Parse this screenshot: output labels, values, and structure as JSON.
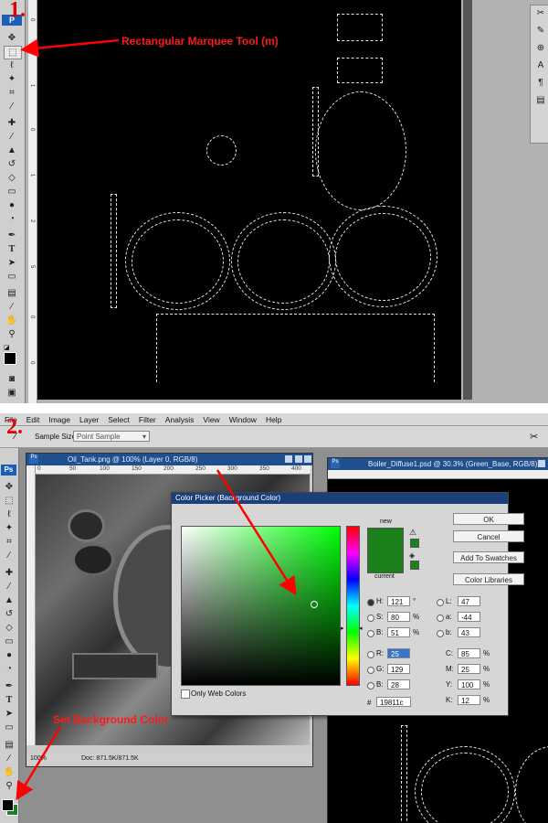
{
  "step1": {
    "number": "1.",
    "annotation": "Rectangular Marquee Tool (m)"
  },
  "step2": {
    "number": "2.",
    "annotation": "Set Background Color"
  },
  "menu": [
    "File",
    "Edit",
    "Image",
    "Layer",
    "Select",
    "Filter",
    "Analysis",
    "View",
    "Window",
    "Help"
  ],
  "options_bar": {
    "sample_size_label": "Sample Size:",
    "sample_size_value": "Point Sample"
  },
  "ps_logo": "Ps",
  "top_ps_logo": "P",
  "ruler_v_top": [
    "0",
    "5",
    "0",
    "1",
    "0",
    "0",
    "0",
    "1",
    "0",
    "0",
    "2",
    "5",
    "0"
  ],
  "doc1": {
    "title": "Oil_Tank.png @ 100% (Layer 0, RGB/8)",
    "ruler_ticks": [
      "0",
      "50",
      "100",
      "150",
      "200",
      "250",
      "300",
      "350",
      "400"
    ],
    "zoom": "100%",
    "doc_size": "Doc: 871.5K/871.5K"
  },
  "doc2": {
    "title": "Boiler_Diffuse1.psd @ 30.3% (Green_Base, RGB/8)"
  },
  "color_picker": {
    "title": "Color Picker (Background Color)",
    "new_label": "new",
    "current_label": "current",
    "ok": "OK",
    "cancel": "Cancel",
    "add_swatches": "Add To Swatches",
    "color_libraries": "Color Libraries",
    "only_web_colors": "Only Web Colors",
    "new_color": "#1b811c",
    "H": {
      "label": "H:",
      "value": "121",
      "unit": "°"
    },
    "S": {
      "label": "S:",
      "value": "80",
      "unit": "%"
    },
    "B": {
      "label": "B:",
      "value": "51",
      "unit": "%"
    },
    "R": {
      "label": "R:",
      "value": "25"
    },
    "G": {
      "label": "G:",
      "value": "129"
    },
    "B2": {
      "label": "B:",
      "value": "28"
    },
    "L": {
      "label": "L:",
      "value": "47"
    },
    "a": {
      "label": "a:",
      "value": "-44"
    },
    "b": {
      "label": "b:",
      "value": "43"
    },
    "C": {
      "label": "C:",
      "value": "85",
      "unit": "%"
    },
    "M": {
      "label": "M:",
      "value": "25",
      "unit": "%"
    },
    "Y": {
      "label": "Y:",
      "value": "100",
      "unit": "%"
    },
    "K": {
      "label": "K:",
      "value": "12",
      "unit": "%"
    },
    "hex_label": "#",
    "hex": "19811c"
  },
  "dock_icons": [
    "tools-icon",
    "brush-preset-icon",
    "channels-icon",
    "clone-source-icon",
    "paragraph-icon",
    "character-icon"
  ],
  "dock_glyphs": [
    "✂",
    "✎",
    "⊕",
    "A",
    "¶",
    "▤"
  ]
}
